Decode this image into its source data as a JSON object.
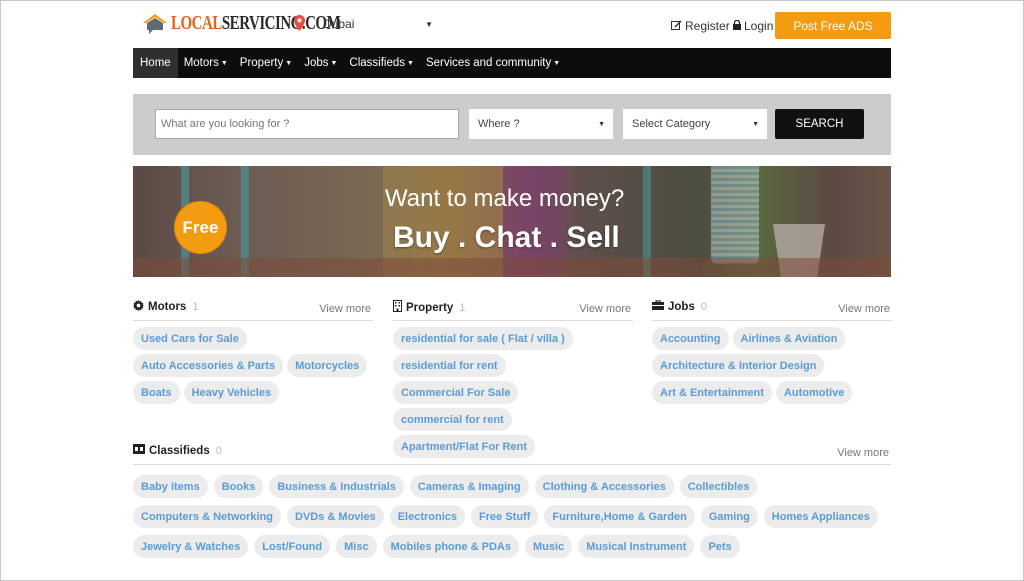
{
  "header": {
    "logo_text_orange": "LOCAL",
    "logo_text_dark": "SERVICING.COM",
    "city": "Dubai",
    "register_label": "Register",
    "login_label": "Login",
    "post_button_label": "Post Free ADS"
  },
  "nav": {
    "items": [
      {
        "label": "Home",
        "dropdown": false,
        "active": true
      },
      {
        "label": "Motors",
        "dropdown": true
      },
      {
        "label": "Property",
        "dropdown": true
      },
      {
        "label": "Jobs",
        "dropdown": true
      },
      {
        "label": "Classifieds",
        "dropdown": true
      },
      {
        "label": "Services and community",
        "dropdown": true
      }
    ]
  },
  "search": {
    "placeholder": "What are you looking for ?",
    "where_value": "Where ?",
    "category_value": "Select Category",
    "button_label": "SEARCH"
  },
  "banner": {
    "badge": "Free",
    "headline": "Want to make money?",
    "tagline": "Buy . Chat . Sell"
  },
  "categories": {
    "motors": {
      "title": "Motors",
      "count": "1",
      "view_more": "View more",
      "items": [
        "Used Cars for Sale",
        "Auto Accessories & Parts",
        "Motorcycles",
        "Boats",
        "Heavy Vehicles"
      ]
    },
    "property": {
      "title": "Property",
      "count": "1",
      "view_more": "View more",
      "items": [
        "residential for sale ( Flat / villa )",
        "residential for rent",
        "Commercial For Sale",
        "commercial for rent",
        "Apartment/Flat For Rent"
      ]
    },
    "jobs": {
      "title": "Jobs",
      "count": "0",
      "view_more": "View more",
      "items": [
        "Accounting",
        "Airlines & Aviation",
        "Architecture & Interior Design",
        "Art & Entertainment",
        "Automotive"
      ]
    },
    "classifieds": {
      "title": "Classifieds",
      "count": "0",
      "view_more": "View more",
      "items": [
        "Baby items",
        "Books",
        "Business & Industrials",
        "Cameras & Imaging",
        "Clothing & Accessories",
        "Collectibles",
        "Computers & Networking",
        "DVDs & Movies",
        "Electronics",
        "Free Stuff",
        "Furniture,Home & Garden",
        "Gaming",
        "Homes Appliances",
        "Jewelry & Watches",
        "Lost/Found",
        "Misc",
        "Mobiles phone & PDAs",
        "Music",
        "Musical Instrument",
        "Pets"
      ]
    }
  },
  "colors": {
    "accent": "#f39c12",
    "nav_bg": "#0d0d0d",
    "chip_text": "#5b9bd5",
    "chip_bg": "#ececec",
    "logo_orange": "#e8621d"
  }
}
